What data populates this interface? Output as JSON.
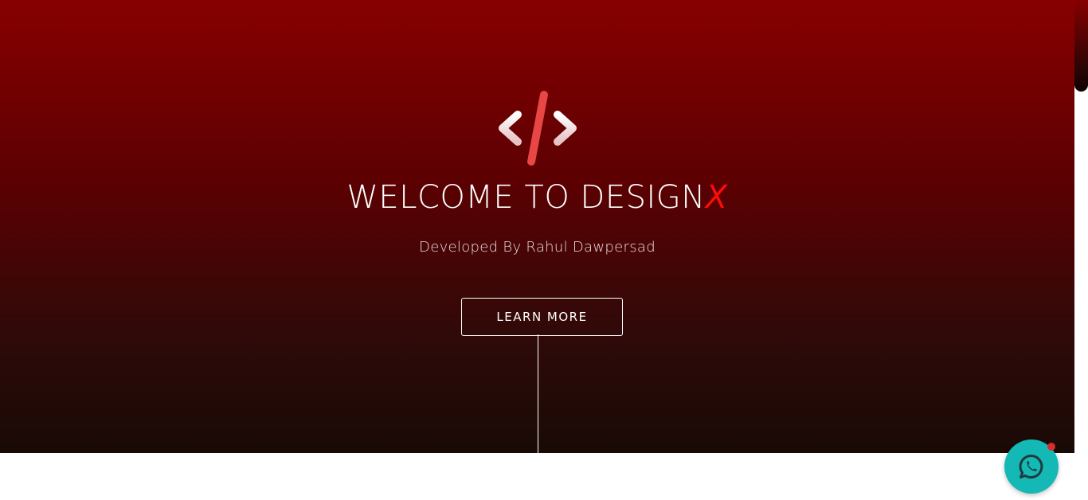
{
  "hero": {
    "title_main": "WELCOME TO DESIGN",
    "title_accent": "X",
    "subtitle": "Developed By Rahul Dawpersad",
    "button_label": "LEARN MORE",
    "logo_icon": "code-brackets-icon"
  },
  "chat_widget": {
    "icon": "whatsapp-icon",
    "has_notification": true
  },
  "colors": {
    "hero_top": "#870000",
    "hero_bottom": "#190a05",
    "accent": "#ff0a0a",
    "chat_button": "#14b8b4",
    "notification_dot": "#d62d2d"
  }
}
